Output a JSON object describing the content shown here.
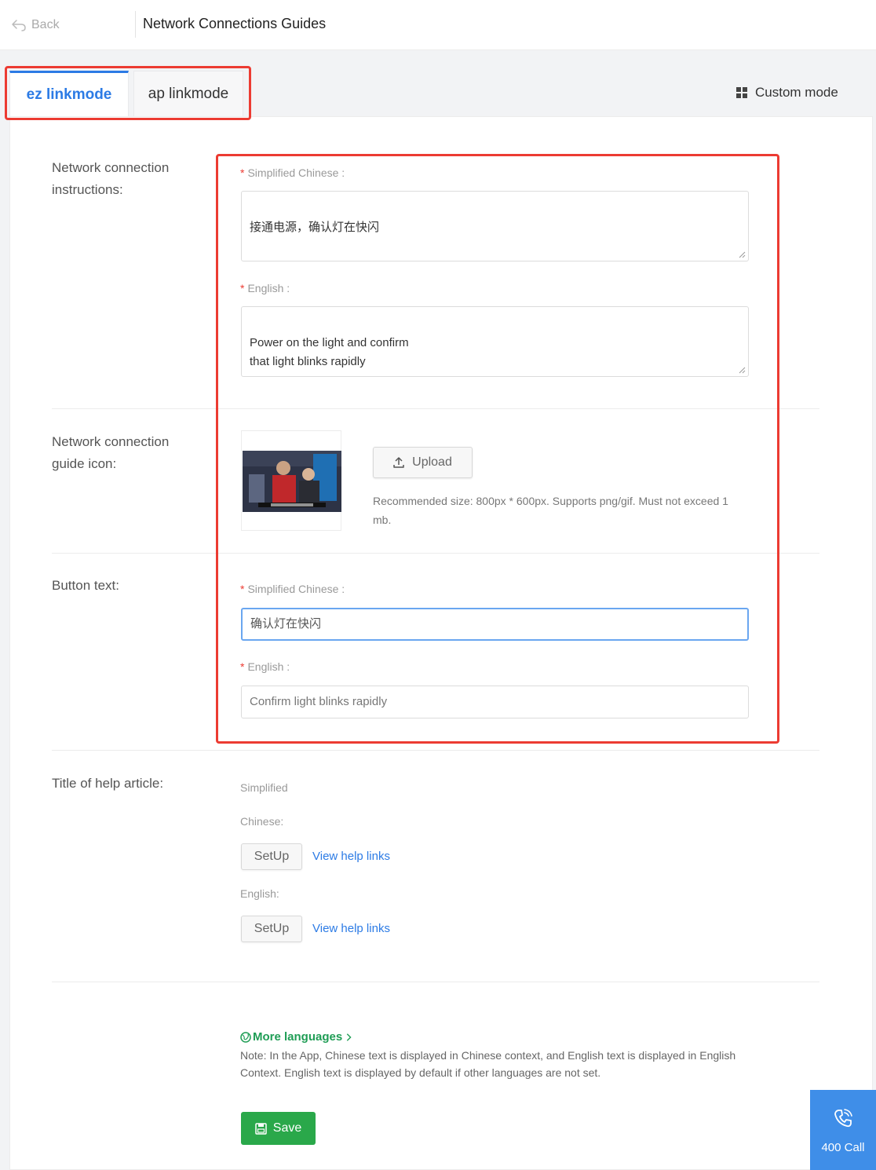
{
  "header": {
    "back_label": "Back",
    "title": "Network Connections Guides"
  },
  "tabs": [
    {
      "label": "ez linkmode",
      "active": true
    },
    {
      "label": "ap linkmode",
      "active": false
    }
  ],
  "custom_mode_label": "Custom mode",
  "instructions": {
    "section_label": "Network connection instructions:",
    "zh_label": "Simplified Chinese :",
    "zh_value": "接通电源，确认灯在快闪",
    "en_label": "English :",
    "en_value": "Power on the light and confirm\nthat light blinks  rapidly"
  },
  "guide_icon": {
    "section_label": "Network connection guide icon:",
    "upload_label": "Upload",
    "hint": "Recommended size: 800px * 600px. Supports png/gif. Must not exceed 1 mb."
  },
  "button_text": {
    "section_label": "Button text:",
    "zh_label": "Simplified Chinese :",
    "zh_value": "确认灯在快闪",
    "en_label": "English :",
    "en_value": "Confirm light blinks rapidly"
  },
  "help_article": {
    "section_label": "Title of help article:",
    "zh_label_line1": "Simplified",
    "zh_label_line2": "Chinese:",
    "en_label": "English:",
    "setup_label": "SetUp",
    "link_label": "View help links"
  },
  "more_languages_label": "More languages",
  "note": "Note: In the App, Chinese text is displayed in Chinese context, and English text is displayed in English Context. English text is displayed by default if other languages are not set.",
  "save_label": "Save",
  "call_label": "400 Call",
  "colors": {
    "accent": "#2c7be5",
    "highlight": "#ec3b32",
    "save": "#2aa84a",
    "call_widget": "#3f8ee8"
  }
}
